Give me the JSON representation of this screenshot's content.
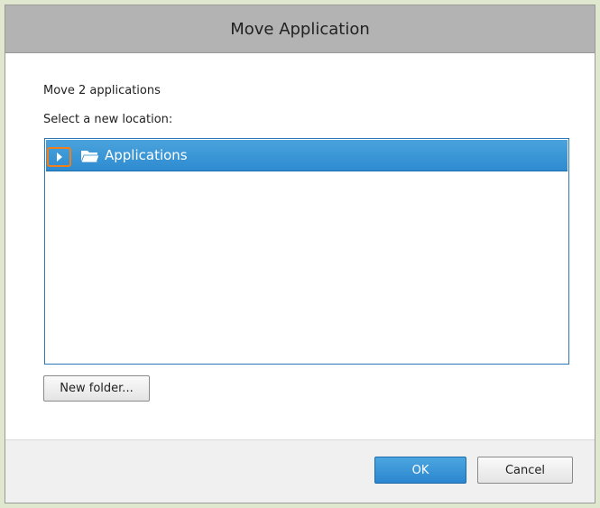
{
  "dialog": {
    "title": "Move Application",
    "move_count_text": "Move 2 applications",
    "select_location_text": "Select a new location:"
  },
  "tree": {
    "items": [
      {
        "label": "Applications",
        "icon": "folder-icon",
        "expander_icon": "expand-arrow-icon",
        "selected": true,
        "expanded": false
      }
    ]
  },
  "buttons": {
    "new_folder": "New folder...",
    "ok": "OK",
    "cancel": "Cancel"
  },
  "colors": {
    "selection": "#2e8bd0",
    "highlight_outline": "#ee7f1a",
    "primary_button": "#2b86cf"
  }
}
